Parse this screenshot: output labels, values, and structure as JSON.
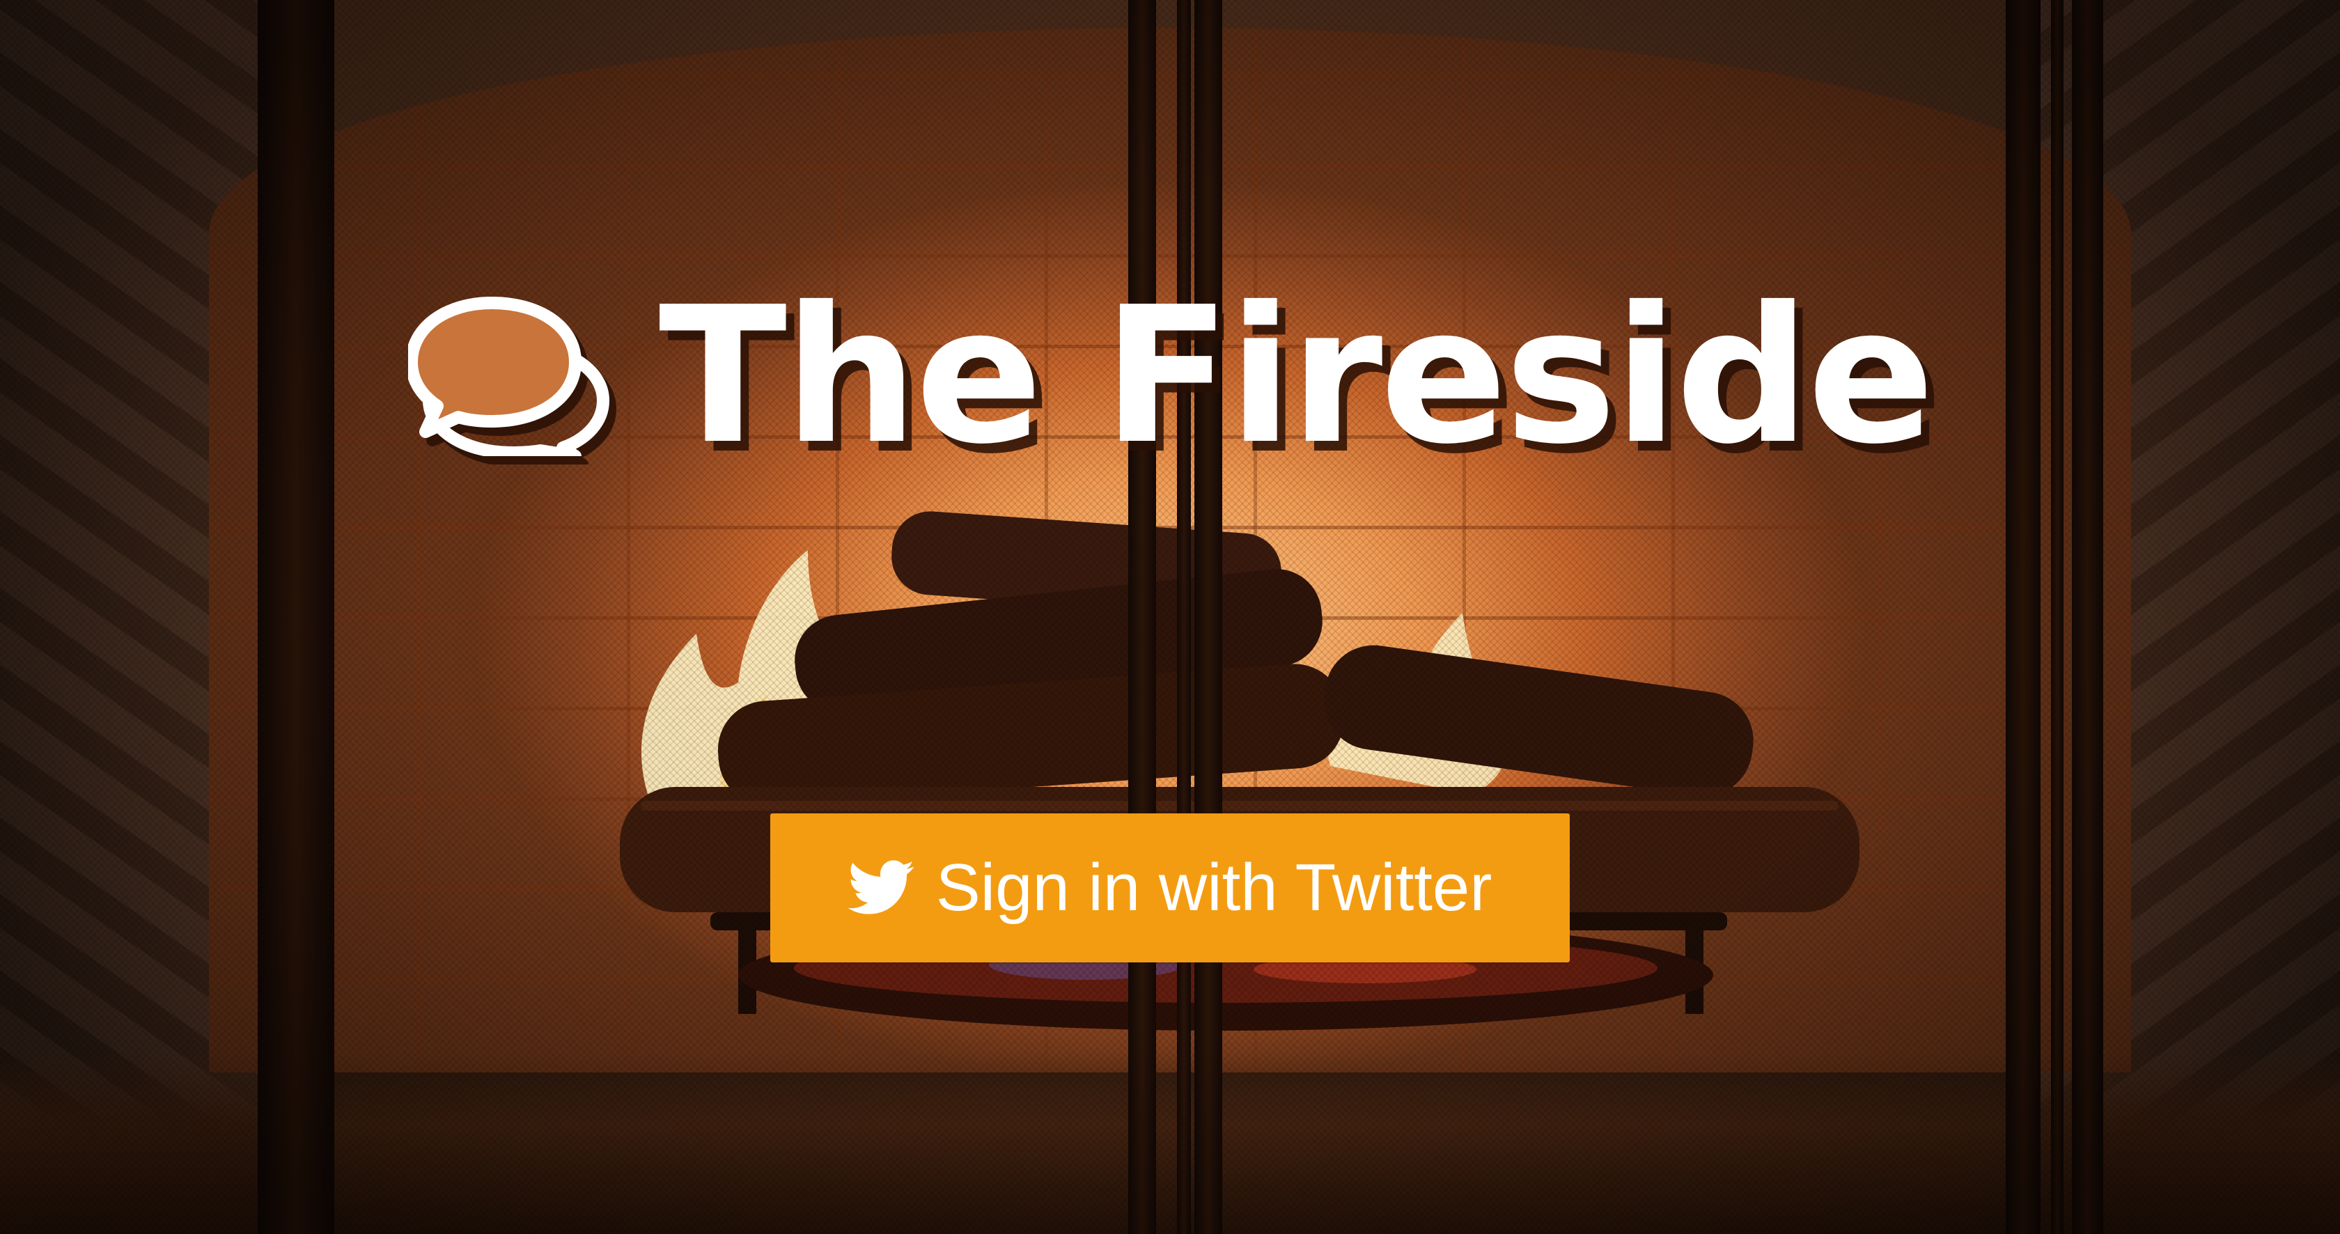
{
  "hero": {
    "title": "The Fireside",
    "logo_icon": "chat-bubbles-icon"
  },
  "signin": {
    "label": "Sign in with Twitter",
    "icon": "twitter-bird-icon",
    "color": "#f39c12"
  },
  "background": {
    "description_icon": "fireplace-background"
  }
}
